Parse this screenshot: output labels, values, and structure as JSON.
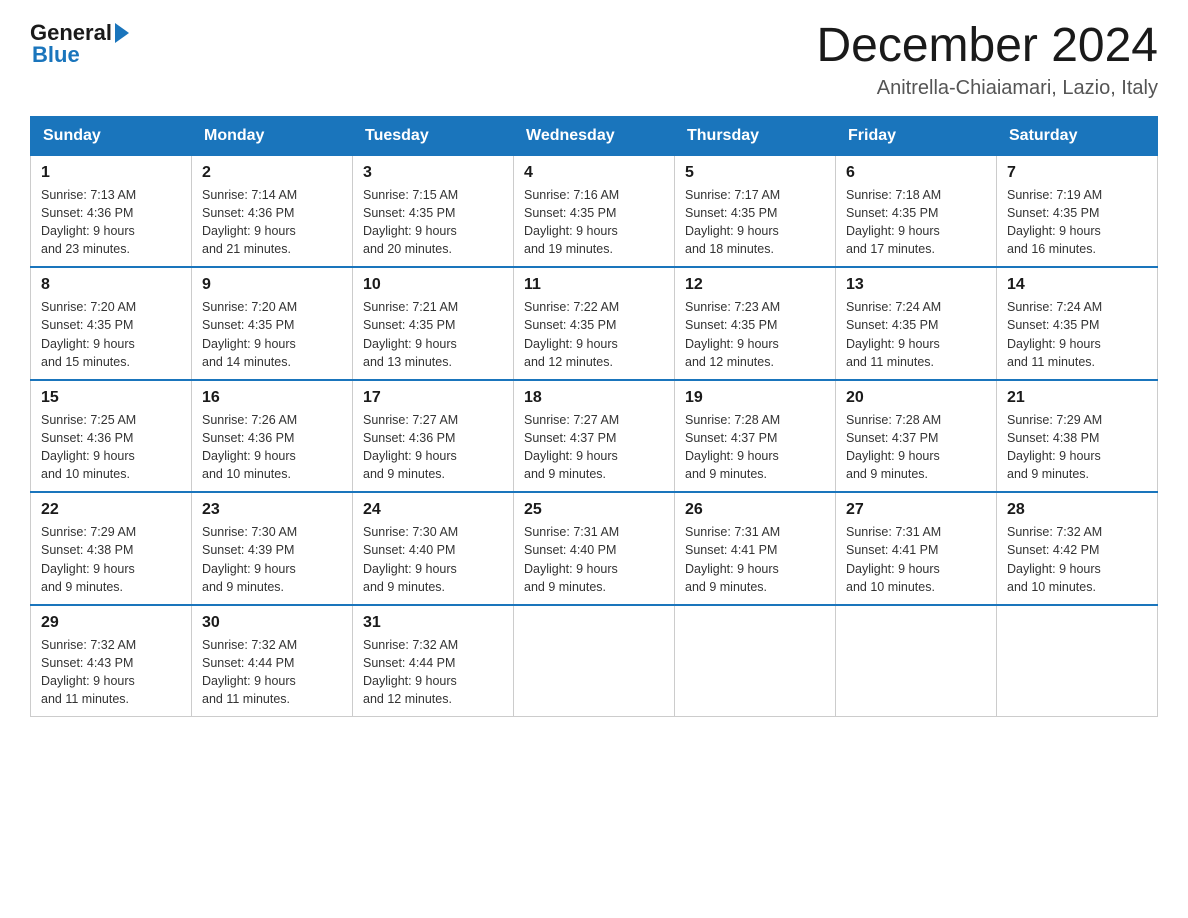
{
  "header": {
    "logo_general": "General",
    "logo_blue": "Blue",
    "month_title": "December 2024",
    "location": "Anitrella-Chiaiamari, Lazio, Italy"
  },
  "days_of_week": [
    "Sunday",
    "Monday",
    "Tuesday",
    "Wednesday",
    "Thursday",
    "Friday",
    "Saturday"
  ],
  "weeks": [
    [
      {
        "day": "1",
        "sunrise": "7:13 AM",
        "sunset": "4:36 PM",
        "daylight": "9 hours and 23 minutes."
      },
      {
        "day": "2",
        "sunrise": "7:14 AM",
        "sunset": "4:36 PM",
        "daylight": "9 hours and 21 minutes."
      },
      {
        "day": "3",
        "sunrise": "7:15 AM",
        "sunset": "4:35 PM",
        "daylight": "9 hours and 20 minutes."
      },
      {
        "day": "4",
        "sunrise": "7:16 AM",
        "sunset": "4:35 PM",
        "daylight": "9 hours and 19 minutes."
      },
      {
        "day": "5",
        "sunrise": "7:17 AM",
        "sunset": "4:35 PM",
        "daylight": "9 hours and 18 minutes."
      },
      {
        "day": "6",
        "sunrise": "7:18 AM",
        "sunset": "4:35 PM",
        "daylight": "9 hours and 17 minutes."
      },
      {
        "day": "7",
        "sunrise": "7:19 AM",
        "sunset": "4:35 PM",
        "daylight": "9 hours and 16 minutes."
      }
    ],
    [
      {
        "day": "8",
        "sunrise": "7:20 AM",
        "sunset": "4:35 PM",
        "daylight": "9 hours and 15 minutes."
      },
      {
        "day": "9",
        "sunrise": "7:20 AM",
        "sunset": "4:35 PM",
        "daylight": "9 hours and 14 minutes."
      },
      {
        "day": "10",
        "sunrise": "7:21 AM",
        "sunset": "4:35 PM",
        "daylight": "9 hours and 13 minutes."
      },
      {
        "day": "11",
        "sunrise": "7:22 AM",
        "sunset": "4:35 PM",
        "daylight": "9 hours and 12 minutes."
      },
      {
        "day": "12",
        "sunrise": "7:23 AM",
        "sunset": "4:35 PM",
        "daylight": "9 hours and 12 minutes."
      },
      {
        "day": "13",
        "sunrise": "7:24 AM",
        "sunset": "4:35 PM",
        "daylight": "9 hours and 11 minutes."
      },
      {
        "day": "14",
        "sunrise": "7:24 AM",
        "sunset": "4:35 PM",
        "daylight": "9 hours and 11 minutes."
      }
    ],
    [
      {
        "day": "15",
        "sunrise": "7:25 AM",
        "sunset": "4:36 PM",
        "daylight": "9 hours and 10 minutes."
      },
      {
        "day": "16",
        "sunrise": "7:26 AM",
        "sunset": "4:36 PM",
        "daylight": "9 hours and 10 minutes."
      },
      {
        "day": "17",
        "sunrise": "7:27 AM",
        "sunset": "4:36 PM",
        "daylight": "9 hours and 9 minutes."
      },
      {
        "day": "18",
        "sunrise": "7:27 AM",
        "sunset": "4:37 PM",
        "daylight": "9 hours and 9 minutes."
      },
      {
        "day": "19",
        "sunrise": "7:28 AM",
        "sunset": "4:37 PM",
        "daylight": "9 hours and 9 minutes."
      },
      {
        "day": "20",
        "sunrise": "7:28 AM",
        "sunset": "4:37 PM",
        "daylight": "9 hours and 9 minutes."
      },
      {
        "day": "21",
        "sunrise": "7:29 AM",
        "sunset": "4:38 PM",
        "daylight": "9 hours and 9 minutes."
      }
    ],
    [
      {
        "day": "22",
        "sunrise": "7:29 AM",
        "sunset": "4:38 PM",
        "daylight": "9 hours and 9 minutes."
      },
      {
        "day": "23",
        "sunrise": "7:30 AM",
        "sunset": "4:39 PM",
        "daylight": "9 hours and 9 minutes."
      },
      {
        "day": "24",
        "sunrise": "7:30 AM",
        "sunset": "4:40 PM",
        "daylight": "9 hours and 9 minutes."
      },
      {
        "day": "25",
        "sunrise": "7:31 AM",
        "sunset": "4:40 PM",
        "daylight": "9 hours and 9 minutes."
      },
      {
        "day": "26",
        "sunrise": "7:31 AM",
        "sunset": "4:41 PM",
        "daylight": "9 hours and 9 minutes."
      },
      {
        "day": "27",
        "sunrise": "7:31 AM",
        "sunset": "4:41 PM",
        "daylight": "9 hours and 10 minutes."
      },
      {
        "day": "28",
        "sunrise": "7:32 AM",
        "sunset": "4:42 PM",
        "daylight": "9 hours and 10 minutes."
      }
    ],
    [
      {
        "day": "29",
        "sunrise": "7:32 AM",
        "sunset": "4:43 PM",
        "daylight": "9 hours and 11 minutes."
      },
      {
        "day": "30",
        "sunrise": "7:32 AM",
        "sunset": "4:44 PM",
        "daylight": "9 hours and 11 minutes."
      },
      {
        "day": "31",
        "sunrise": "7:32 AM",
        "sunset": "4:44 PM",
        "daylight": "9 hours and 12 minutes."
      },
      null,
      null,
      null,
      null
    ]
  ],
  "labels": {
    "sunrise": "Sunrise:",
    "sunset": "Sunset:",
    "daylight": "Daylight:"
  }
}
